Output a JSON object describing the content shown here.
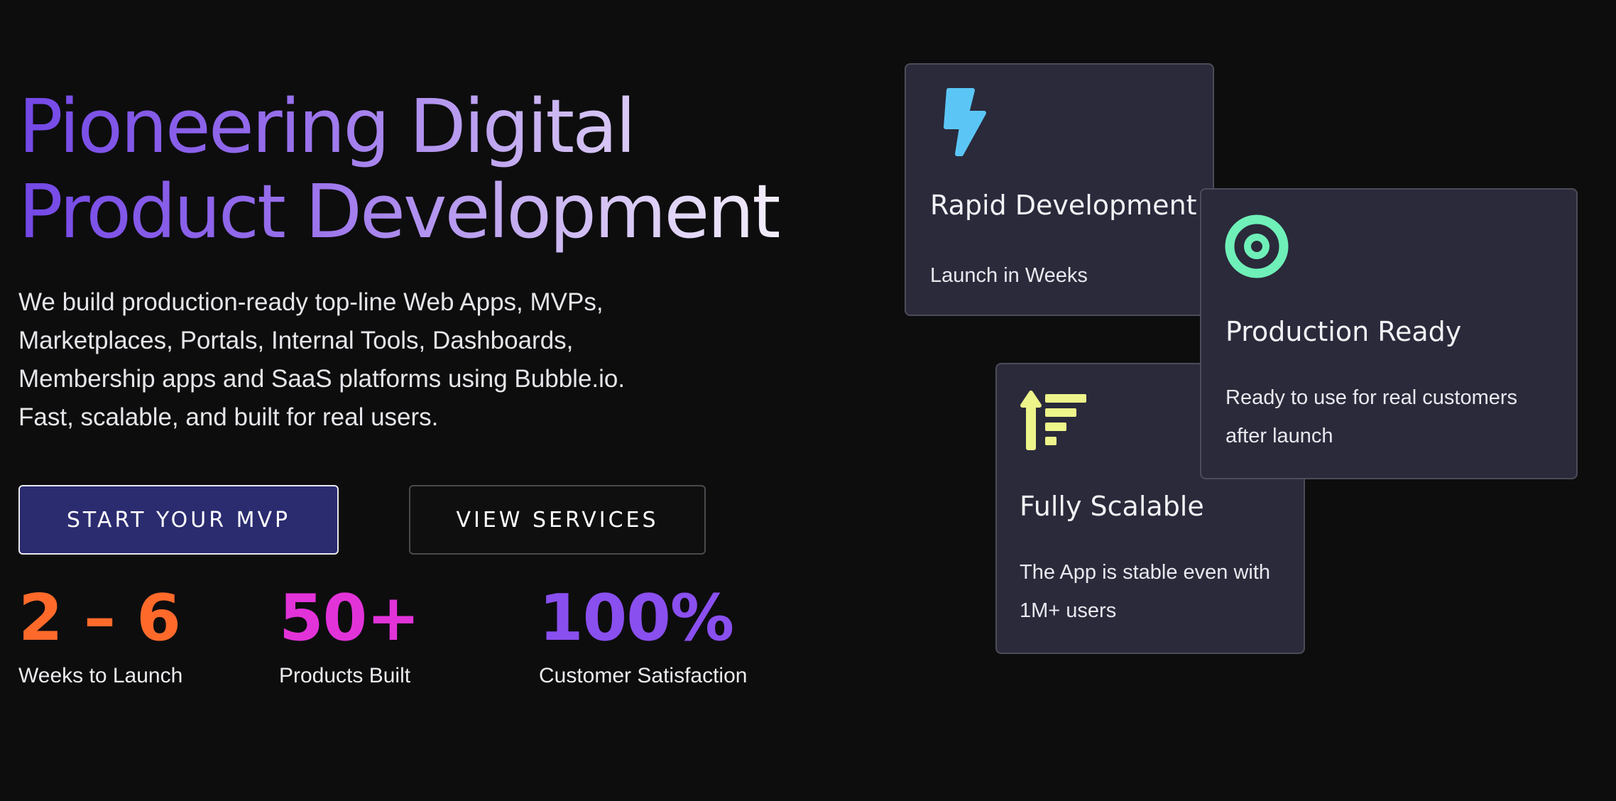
{
  "hero": {
    "title_lines": [
      "Pioneering Digital",
      "Product Development"
    ],
    "description_lines": [
      "We build production-ready top-line Web Apps, MVPs,",
      "Marketplaces, Portals, Internal Tools, Dashboards,",
      "Membership apps and SaaS platforms using Bubble.io.",
      "Fast, scalable, and built for real users."
    ]
  },
  "buttons": {
    "primary_label": "START YOUR MVP",
    "secondary_label": "VIEW SERVICES"
  },
  "stats": [
    {
      "value": "2 – 6",
      "label": "Weeks to Launch",
      "color": "#ff6a2b"
    },
    {
      "value": "50+",
      "label": "Products Built",
      "color": "#e233d9"
    },
    {
      "value": "100%",
      "label": "Customer Satisfaction",
      "color": "#8a4fef"
    }
  ],
  "cards": {
    "rapid": {
      "title": "Rapid Development",
      "desc_lines": [
        "Launch in Weeks"
      ],
      "icon": "lightning-icon",
      "icon_color": "#5bc6f5"
    },
    "production": {
      "title": "Production Ready",
      "desc_lines": [
        "Ready to use for real customers",
        "after launch"
      ],
      "icon": "target-icon",
      "icon_color": "#6ff0b8"
    },
    "scalable": {
      "title": "Fully Scalable",
      "desc_lines": [
        "The App is stable even with",
        "1M+ users"
      ],
      "icon": "sort-ascending-icon",
      "icon_color": "#eef58a"
    }
  },
  "colors": {
    "background": "#0d0d0e",
    "card_background": "#2a2a3b",
    "primary_button": "#2b2b70"
  }
}
